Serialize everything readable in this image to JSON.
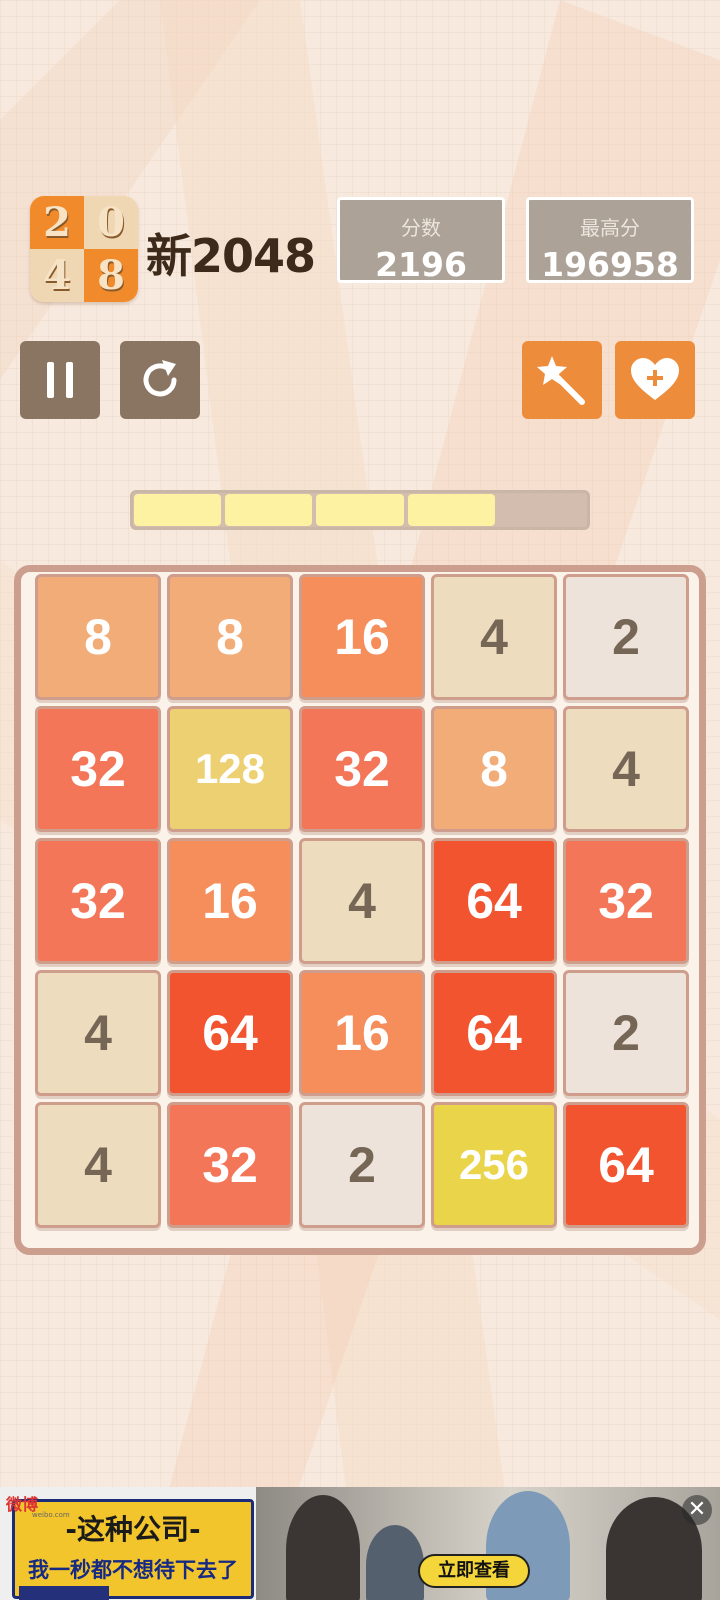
{
  "app": {
    "title": "新2048",
    "logo_digits": [
      "2",
      "0",
      "4",
      "8"
    ]
  },
  "scores": {
    "current_label": "分数",
    "current_value": "2196",
    "best_label": "最高分",
    "best_value": "196958"
  },
  "toolbar": {
    "pause_icon": "pause-icon",
    "restart_icon": "restart-icon",
    "magic_icon": "magic-wand-icon",
    "heart_icon": "heart-plus-icon"
  },
  "progress": {
    "segments_total": 5,
    "segments_filled": 4
  },
  "board": {
    "size": 5,
    "rows": [
      [
        8,
        8,
        16,
        4,
        2
      ],
      [
        32,
        128,
        32,
        8,
        4
      ],
      [
        32,
        16,
        4,
        64,
        32
      ],
      [
        4,
        64,
        16,
        64,
        2
      ],
      [
        4,
        32,
        2,
        256,
        64
      ]
    ]
  },
  "tile_colors": {
    "2": "#ede3da",
    "4": "#eddcbd",
    "8": "#f2ac78",
    "16": "#f58e5a",
    "32": "#f47659",
    "64": "#f2542f",
    "128": "#edd072",
    "256": "#e9d44a"
  },
  "ad": {
    "brand": "微博",
    "brand_sub": "weibo.com",
    "headline": "-这种公司-",
    "subline": "我一秒都不想待下去了",
    "cta": "立即查看",
    "close": "✕"
  }
}
